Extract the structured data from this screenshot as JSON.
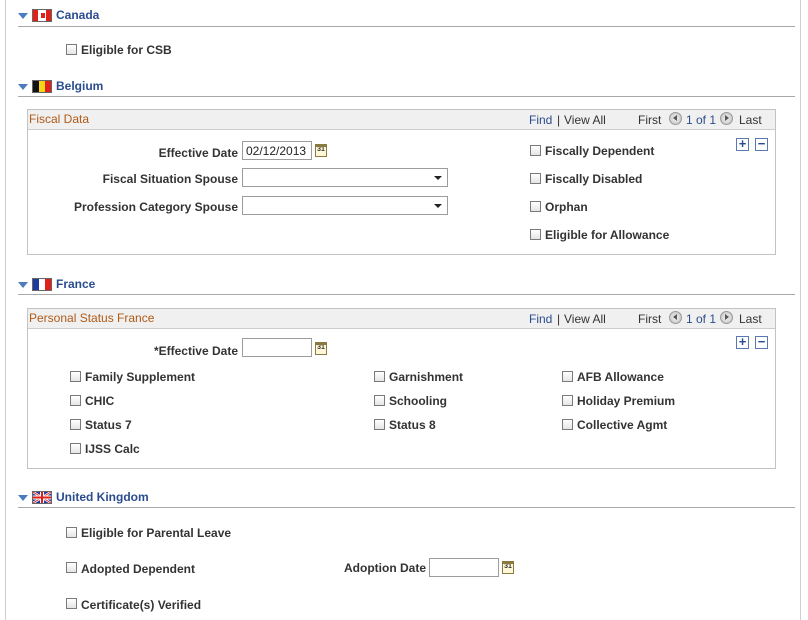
{
  "canada": {
    "title": "Canada",
    "eligible_csb": "Eligible for CSB"
  },
  "belgium": {
    "title": "Belgium",
    "fiscal": {
      "title": "Fiscal Data",
      "find": "Find",
      "pipe": "|",
      "view_all": "View All",
      "first": "First",
      "count": "1 of 1",
      "last": "Last",
      "effective_date_label": "Effective Date",
      "effective_date_value": "02/12/2013",
      "fiscal_situation_label": "Fiscal Situation Spouse",
      "profession_category_label": "Profession Category Spouse",
      "fiscally_dependent": "Fiscally Dependent",
      "fiscally_disabled": "Fiscally Disabled",
      "orphan": "Orphan",
      "eligible_allowance": "Eligible for Allowance"
    }
  },
  "france": {
    "title": "France",
    "personal": {
      "title": "Personal Status France",
      "find": "Find",
      "pipe": "|",
      "view_all": "View All",
      "first": "First",
      "count": "1 of 1",
      "last": "Last",
      "effective_date_label": "*Effective Date",
      "effective_date_value": "",
      "family_supplement": "Family Supplement",
      "chic": "CHIC",
      "status7": "Status 7",
      "ijss_calc": "IJSS Calc",
      "garnishment": "Garnishment",
      "schooling": "Schooling",
      "status8": "Status 8",
      "afb_allowance": "AFB Allowance",
      "holiday_premium": "Holiday Premium",
      "collective_agmt": "Collective Agmt"
    }
  },
  "uk": {
    "title": "United Kingdom",
    "parental_leave": "Eligible for Parental Leave",
    "adopted_dependent": "Adopted Dependent",
    "adoption_date_label": "Adoption Date",
    "adoption_date_value": "",
    "certificates_verified": "Certificate(s) Verified"
  },
  "icons": {
    "calendar_glyph": "31",
    "add_glyph": "+",
    "remove_glyph": "−"
  }
}
